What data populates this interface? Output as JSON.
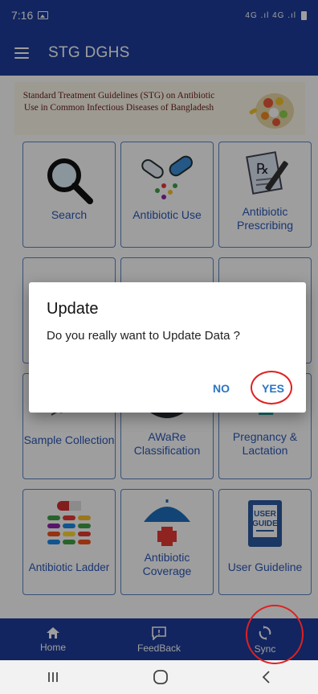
{
  "status_bar": {
    "time": "7:16",
    "indicators": "4G .ıl 4G .ıl"
  },
  "app_bar": {
    "title": "STG DGHS"
  },
  "banner": {
    "text": "Standard Treatment Guidelines (STG) on Antibiotic Use in Common Infectious Diseases of Bangladesh"
  },
  "tiles": [
    {
      "label": "Search",
      "icon": "magnifier-icon"
    },
    {
      "label": "Antibiotic Use",
      "icon": "capsule-icon"
    },
    {
      "label": "Antibiotic Prescribing",
      "icon": "prescription-icon"
    },
    {
      "label": "",
      "icon": "hidden-tile-icon"
    },
    {
      "label": "",
      "icon": "doctor-icon"
    },
    {
      "label": "",
      "icon": "paperclip-icon"
    },
    {
      "label": "Sample Collection",
      "icon": "syringe-icon"
    },
    {
      "label": "AWaRe Classification",
      "icon": "shield-icon"
    },
    {
      "label": "Pregnancy & Lactation",
      "icon": "pregnancy-icon"
    },
    {
      "label": "Antibiotic Ladder",
      "icon": "pill-ladder-icon"
    },
    {
      "label": "Antibiotic Coverage",
      "icon": "umbrella-icon"
    },
    {
      "label": "User Guideline",
      "icon": "user-guide-book-icon"
    }
  ],
  "user_guide_book": {
    "line1": "USER",
    "line2": "GUIDE"
  },
  "bottom_nav": [
    {
      "label": "Home",
      "icon": "home-icon"
    },
    {
      "label": "FeedBack",
      "icon": "feedback-icon"
    },
    {
      "label": "Sync",
      "icon": "sync-icon"
    }
  ],
  "dialog": {
    "title": "Update",
    "message": "Do you really want to Update Data ?",
    "no_label": "NO",
    "yes_label": "YES"
  },
  "colors": {
    "primary": "#1e3c9c",
    "tile_border": "#5a84c6",
    "tile_text": "#2b58b6",
    "dialog_button": "#2a75c4",
    "highlight_ring": "#e02020"
  }
}
